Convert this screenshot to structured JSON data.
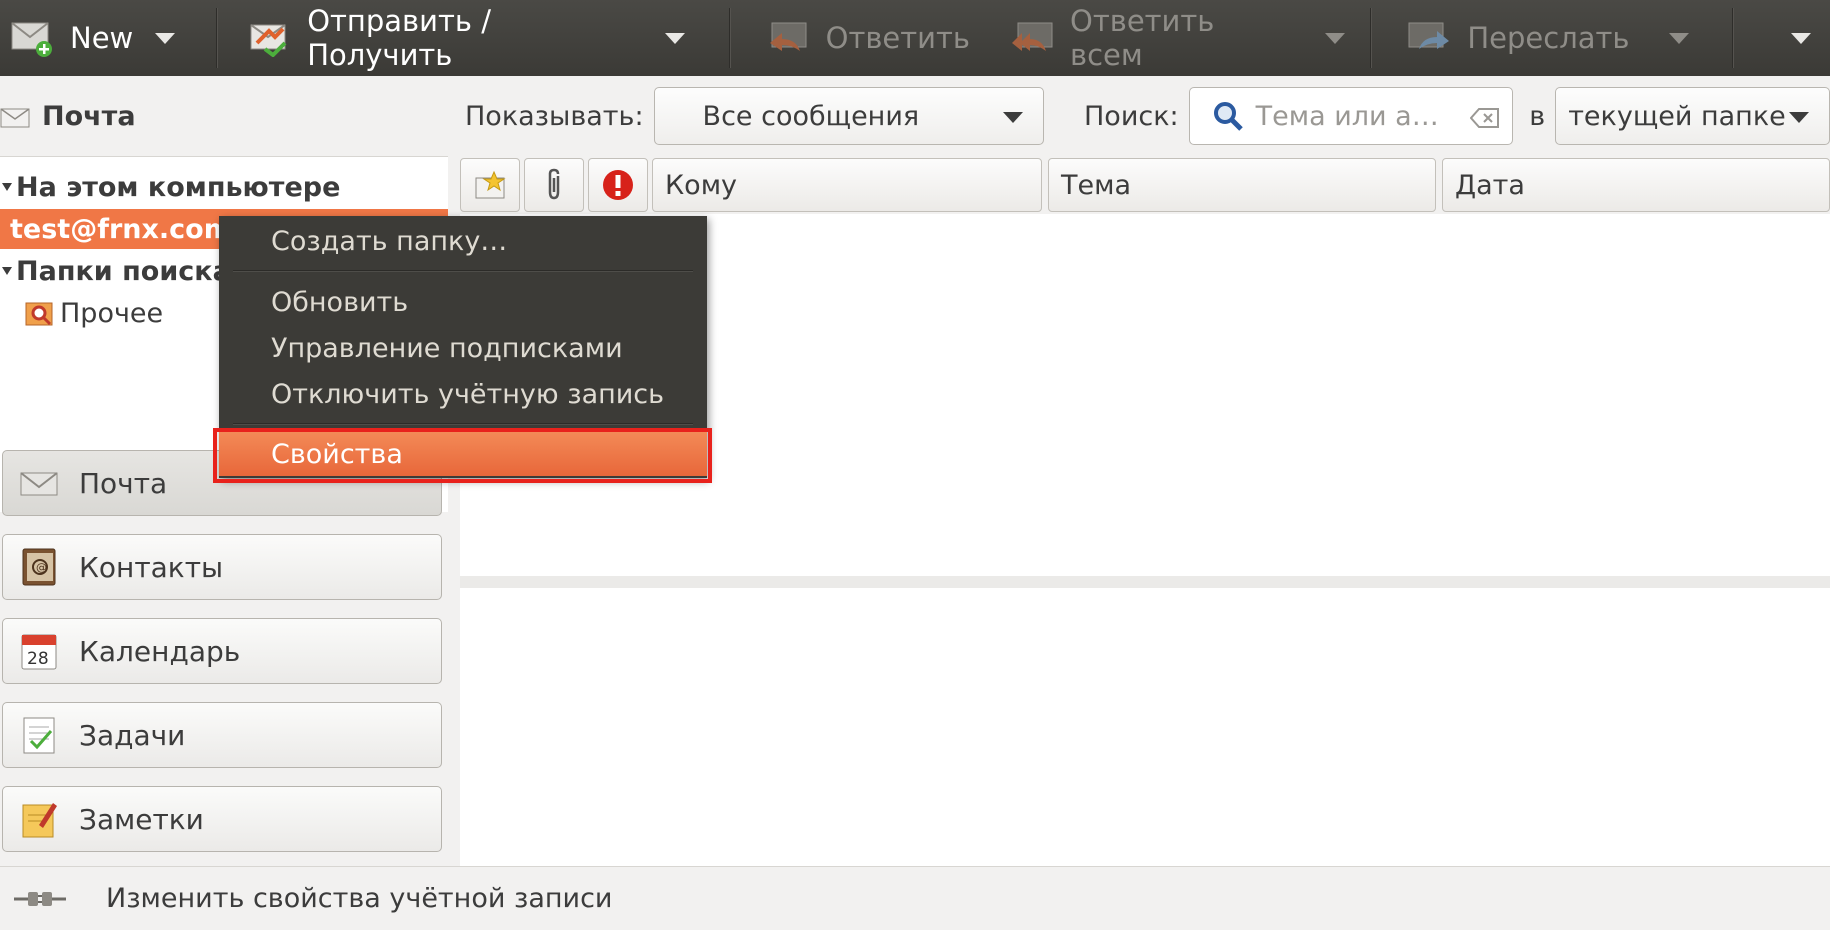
{
  "toolbar": {
    "new_label": "New",
    "send_receive_label": "Отправить / Получить",
    "reply_label": "Ответить",
    "reply_all_label": "Ответить всем",
    "forward_label": "Переслать"
  },
  "left_header": "Почта",
  "tree": {
    "on_this_computer": "На этом компьютере",
    "account": "test@frnx.com",
    "search_folders": "Папки поиска",
    "other": "Прочее"
  },
  "side_buttons": {
    "mail": "Почта",
    "contacts": "Контакты",
    "calendar": "Календарь",
    "calendar_day": "28",
    "tasks": "Задачи",
    "notes": "Заметки"
  },
  "filter": {
    "show_label": "Показывать:",
    "show_value": "Все сообщения",
    "search_label": "Поиск:",
    "search_placeholder": "Тема или а…",
    "in_label": "в",
    "scope_value": "текущей папке"
  },
  "columns": {
    "to": "Кому",
    "subject": "Тема",
    "date": "Дата"
  },
  "context_menu": {
    "create_folder": "Создать папку…",
    "refresh": "Обновить",
    "manage_subscriptions": "Управление подписками",
    "disable_account": "Отключить учётную запись",
    "properties": "Свойства"
  },
  "status": {
    "text": "Изменить свойства учётной записи"
  },
  "colors": {
    "accent": "#f07746",
    "toolbar_bg": "#3c3b37",
    "highlight_frame": "#e8221c"
  },
  "icons": [
    "new-mail-icon",
    "send-receive-icon",
    "reply-icon",
    "reply-all-icon",
    "forward-icon",
    "mail-icon",
    "search-folder-icon",
    "contacts-icon",
    "calendar-icon",
    "tasks-icon",
    "notes-icon",
    "flag-icon",
    "attachment-icon",
    "important-icon",
    "search-icon",
    "clear-icon",
    "connection-icon"
  ]
}
